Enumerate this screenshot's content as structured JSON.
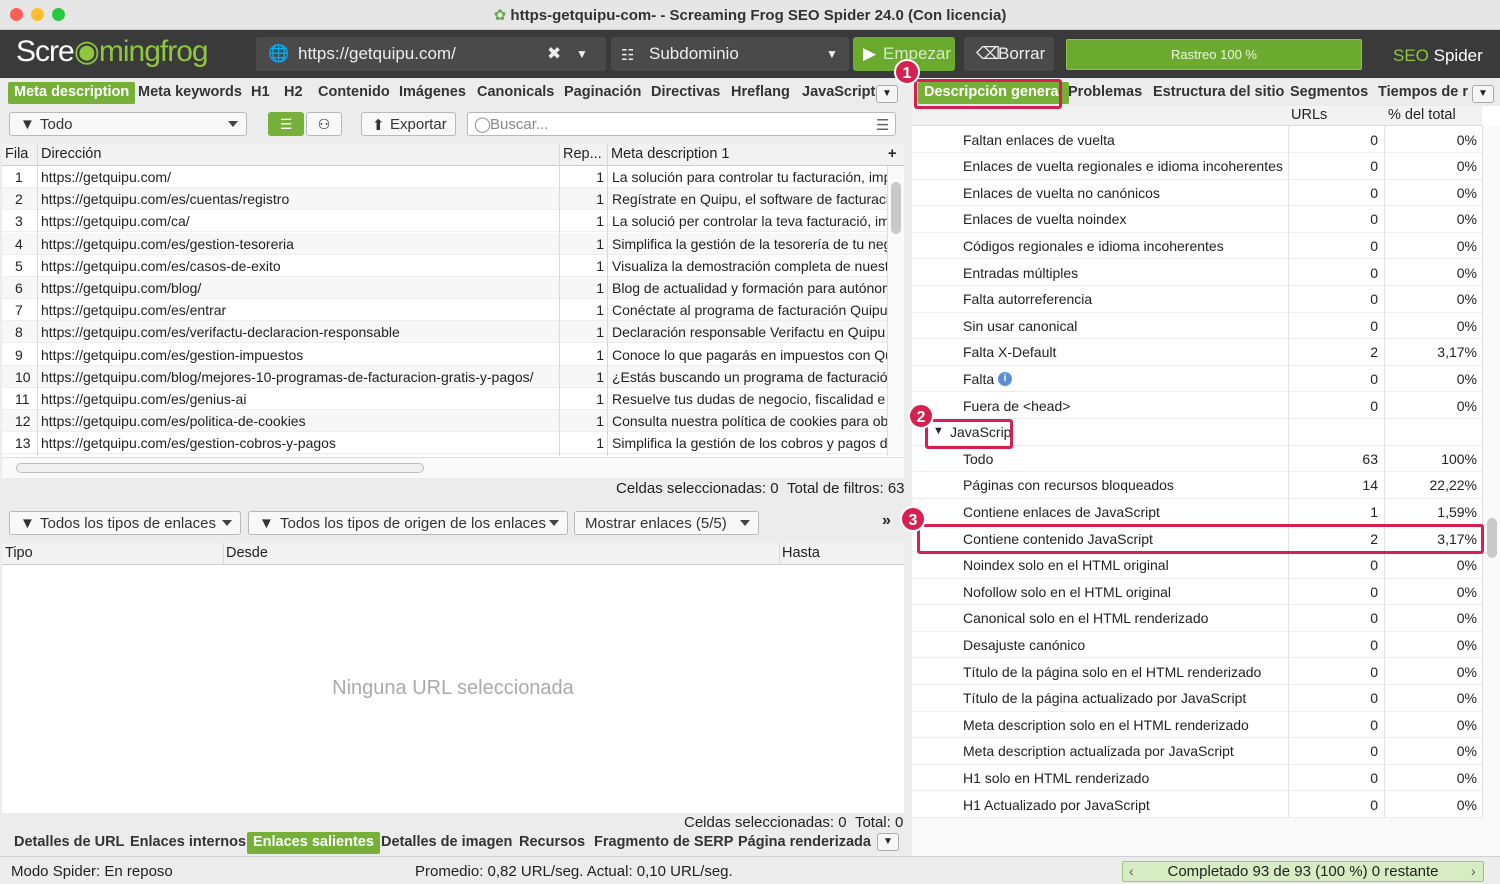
{
  "window": {
    "title": "https-getquipu-com- - Screaming Frog SEO Spider 24.0 (Con licencia)"
  },
  "toolbar": {
    "logo_a": "Scre",
    "logo_b": "mingfrog",
    "url": "https://getquipu.com/",
    "mode": "Subdominio",
    "start_label": "Empezar",
    "clear_label": "Borrar",
    "progress_label": "Rastreo 100 %",
    "progress_value": 100,
    "seo_a": "SEO",
    "seo_b": "Spider"
  },
  "left_tabs": [
    "Meta description",
    "Meta keywords",
    "H1",
    "H2",
    "Contenido",
    "Imágenes",
    "Canonicals",
    "Paginación",
    "Directivas",
    "Hreflang",
    "JavaScript"
  ],
  "left_filter": {
    "select": "Todo",
    "export_label": "Exportar",
    "search_placeholder": "Buscar..."
  },
  "main_table": {
    "headers": [
      "Fila",
      "Dirección",
      "Rep...",
      "Meta description 1"
    ],
    "rows": [
      [
        "1",
        "https://getquipu.com/",
        "1",
        "La solución para controlar tu facturación, impu"
      ],
      [
        "2",
        "https://getquipu.com/es/cuentas/registro",
        "1",
        "Regístrate en Quipu, el software de facturación"
      ],
      [
        "3",
        "https://getquipu.com/ca/",
        "1",
        "La solució per controlar la teva facturació, imp"
      ],
      [
        "4",
        "https://getquipu.com/es/gestion-tesoreria",
        "1",
        "Simplifica la gestión de la tesorería de tu nego"
      ],
      [
        "5",
        "https://getquipu.com/es/casos-de-exito",
        "1",
        "Visualiza la demostración completa de nuestro"
      ],
      [
        "6",
        "https://getquipu.com/blog/",
        "1",
        "Blog de actualidad y formación para autónomo"
      ],
      [
        "7",
        "https://getquipu.com/es/entrar",
        "1",
        "Conéctate al programa de facturación Quipu, e"
      ],
      [
        "8",
        "https://getquipu.com/es/verifactu-declaracion-responsable",
        "1",
        "Declaración responsable Verifactu en Quipu"
      ],
      [
        "9",
        "https://getquipu.com/es/gestion-impuestos",
        "1",
        "Conoce lo que pagarás en impuestos con Quip"
      ],
      [
        "10",
        "https://getquipu.com/blog/mejores-10-programas-de-facturacion-gratis-y-pagos/",
        "1",
        "¿Estás buscando un programa de facturación"
      ],
      [
        "11",
        "https://getquipu.com/es/genius-ai",
        "1",
        "Resuelve tus dudas de negocio, fiscalidad e i"
      ],
      [
        "12",
        "https://getquipu.com/es/politica-de-cookies",
        "1",
        "Consulta nuestra política de cookies para obte"
      ],
      [
        "13",
        "https://getquipu.com/es/gestion-cobros-y-pagos",
        "1",
        "Simplifica la gestión de los cobros y pagos de"
      ]
    ],
    "status_selected_label": "Celdas seleccionadas:",
    "status_selected": "0",
    "status_total_label": "Total de filtros:",
    "status_total": "63"
  },
  "links_filter": {
    "types": "Todos los tipos de enlaces",
    "origins": "Todos los tipos de origen de los enlaces",
    "show": "Mostrar enlaces (5/5)"
  },
  "links_table": {
    "headers": [
      "Tipo",
      "Desde",
      "Hasta"
    ],
    "empty": "Ninguna URL seleccionada",
    "status_selected_label": "Celdas seleccionadas:",
    "status_selected": "0",
    "status_total_label": "Total:",
    "status_total": "0"
  },
  "bottom_tabs": [
    "Detalles de URL",
    "Enlaces internos",
    "Enlaces salientes",
    "Detalles de imagen",
    "Recursos",
    "Fragmento de SERP",
    "Página renderizada"
  ],
  "right_tabs": [
    "Descripción general",
    "Problemas",
    "Estructura del sitio",
    "Segmentos",
    "Tiempos de re"
  ],
  "overview": {
    "headers": [
      "URLs",
      "% del total"
    ],
    "rows": [
      [
        "Faltan enlaces de vuelta",
        "0",
        "0%"
      ],
      [
        "Enlaces de vuelta regionales e idioma incoherentes",
        "0",
        "0%"
      ],
      [
        "Enlaces de vuelta no canónicos",
        "0",
        "0%"
      ],
      [
        "Enlaces de vuelta noindex",
        "0",
        "0%"
      ],
      [
        "Códigos regionales e idioma incoherentes",
        "0",
        "0%"
      ],
      [
        "Entradas múltiples",
        "0",
        "0%"
      ],
      [
        "Falta autorreferencia",
        "0",
        "0%"
      ],
      [
        "Sin usar canonical",
        "0",
        "0%"
      ],
      [
        "Falta X-Default",
        "2",
        "3,17%"
      ],
      [
        "Falta",
        "0",
        "0%"
      ],
      [
        "Fuera de <head>",
        "0",
        "0%"
      ]
    ],
    "group": "JavaScrip",
    "js_rows": [
      [
        "Todo",
        "63",
        "100%"
      ],
      [
        "Páginas con recursos bloqueados",
        "14",
        "22,22%"
      ],
      [
        "Contiene enlaces de JavaScript",
        "1",
        "1,59%"
      ],
      [
        "Contiene contenido JavaScript",
        "2",
        "3,17%"
      ],
      [
        "Noindex solo en el HTML original",
        "0",
        "0%"
      ],
      [
        "Nofollow solo en el HTML original",
        "0",
        "0%"
      ],
      [
        "Canonical solo en el HTML renderizado",
        "0",
        "0%"
      ],
      [
        "Desajuste canónico",
        "0",
        "0%"
      ],
      [
        "Título de la página solo en el HTML renderizado",
        "0",
        "0%"
      ],
      [
        "Título de la página actualizado por JavaScript",
        "0",
        "0%"
      ],
      [
        "Meta description solo en el HTML renderizado",
        "0",
        "0%"
      ],
      [
        "Meta description actualizada por JavaScript",
        "0",
        "0%"
      ],
      [
        "H1 solo en HTML renderizado",
        "0",
        "0%"
      ],
      [
        "H1 Actualizado por JavaScript",
        "0",
        "0%"
      ]
    ]
  },
  "badges": [
    "1",
    "2",
    "3"
  ],
  "status_bar": {
    "mode": "Modo Spider: En reposo",
    "speed": "Promedio: 0,82 URL/seg. Actual: 0,10 URL/seg.",
    "completed": "Completado 93 de 93 (100 %) 0 restante"
  },
  "colors": {
    "accent": "#76b038",
    "highlight": "#d6204f",
    "toolbar": "#3a3a3a"
  }
}
